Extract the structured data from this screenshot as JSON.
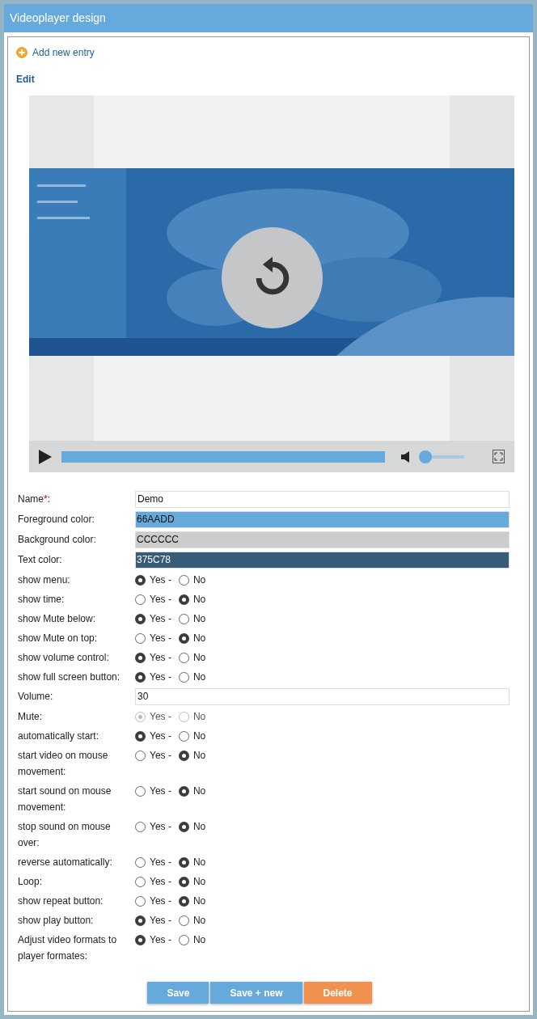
{
  "window": {
    "title": "Videoplayer design"
  },
  "add_link": "Add new entry",
  "section_title": "Edit",
  "player": {
    "progress": {
      "level": 1
    },
    "volume": {
      "level": 0
    }
  },
  "fields": [
    {
      "kind": "text",
      "label": "Name",
      "required_mark": "*",
      "suffix": ":",
      "value": "Demo"
    },
    {
      "kind": "color",
      "label": "Foreground color:",
      "value": "66AADD",
      "color": "#66aadd"
    },
    {
      "kind": "color",
      "label": "Background color:",
      "value": "CCCCCC",
      "color": "#cccccc"
    },
    {
      "kind": "color",
      "label": "Text color:",
      "value": "375C78",
      "color": "#375c78"
    },
    {
      "kind": "radio",
      "label": "show menu:",
      "disabled": false,
      "options": [
        {
          "label": "Yes -",
          "selected": true
        },
        {
          "label": "No",
          "selected": false
        }
      ]
    },
    {
      "kind": "radio",
      "label": "show time:",
      "disabled": false,
      "options": [
        {
          "label": "Yes -",
          "selected": false
        },
        {
          "label": "No",
          "selected": true
        }
      ]
    },
    {
      "kind": "radio",
      "label": "show Mute below:",
      "disabled": false,
      "options": [
        {
          "label": "Yes -",
          "selected": true
        },
        {
          "label": "No",
          "selected": false
        }
      ]
    },
    {
      "kind": "radio",
      "label": "show Mute on top:",
      "disabled": false,
      "options": [
        {
          "label": "Yes -",
          "selected": false
        },
        {
          "label": "No",
          "selected": true
        }
      ]
    },
    {
      "kind": "radio",
      "label": "show volume control:",
      "disabled": false,
      "options": [
        {
          "label": "Yes -",
          "selected": true
        },
        {
          "label": "No",
          "selected": false
        }
      ]
    },
    {
      "kind": "radio",
      "label": "show full screen button:",
      "disabled": false,
      "options": [
        {
          "label": "Yes -",
          "selected": true
        },
        {
          "label": "No",
          "selected": false
        }
      ]
    },
    {
      "kind": "text",
      "label": "Volume:",
      "value": "30"
    },
    {
      "kind": "radio",
      "label": "Mute:",
      "disabled": true,
      "options": [
        {
          "label": "Yes -",
          "selected": true
        },
        {
          "label": "No",
          "selected": false
        }
      ]
    },
    {
      "kind": "radio",
      "label": "automatically start:",
      "disabled": false,
      "options": [
        {
          "label": "Yes -",
          "selected": true
        },
        {
          "label": "No",
          "selected": false
        }
      ]
    },
    {
      "kind": "radio",
      "label": "start video on mouse movement:",
      "disabled": false,
      "options": [
        {
          "label": "Yes -",
          "selected": false
        },
        {
          "label": "No",
          "selected": true
        }
      ]
    },
    {
      "kind": "radio",
      "label": "start sound on mouse movement:",
      "disabled": false,
      "options": [
        {
          "label": "Yes -",
          "selected": false
        },
        {
          "label": "No",
          "selected": true
        }
      ]
    },
    {
      "kind": "radio",
      "label": "stop sound on mouse over:",
      "disabled": false,
      "options": [
        {
          "label": "Yes -",
          "selected": false
        },
        {
          "label": "No",
          "selected": true
        }
      ]
    },
    {
      "kind": "radio",
      "label": "reverse automatically:",
      "disabled": false,
      "options": [
        {
          "label": "Yes -",
          "selected": false
        },
        {
          "label": "No",
          "selected": true
        }
      ]
    },
    {
      "kind": "radio",
      "label": "Loop:",
      "disabled": false,
      "options": [
        {
          "label": "Yes -",
          "selected": false
        },
        {
          "label": "No",
          "selected": true
        }
      ]
    },
    {
      "kind": "radio",
      "label": "show repeat button:",
      "disabled": false,
      "options": [
        {
          "label": "Yes -",
          "selected": false
        },
        {
          "label": "No",
          "selected": true
        }
      ]
    },
    {
      "kind": "radio",
      "label": "show play button:",
      "disabled": false,
      "options": [
        {
          "label": "Yes -",
          "selected": true
        },
        {
          "label": "No",
          "selected": false
        }
      ]
    },
    {
      "kind": "radio",
      "label": "Adjust video formats to player formates:",
      "disabled": false,
      "options": [
        {
          "label": "Yes -",
          "selected": true
        },
        {
          "label": "No",
          "selected": false
        }
      ]
    }
  ],
  "buttons": [
    {
      "kind": "primary",
      "label": "Save"
    },
    {
      "kind": "primary",
      "label": "Save + new"
    },
    {
      "kind": "danger",
      "label": "Delete"
    }
  ]
}
